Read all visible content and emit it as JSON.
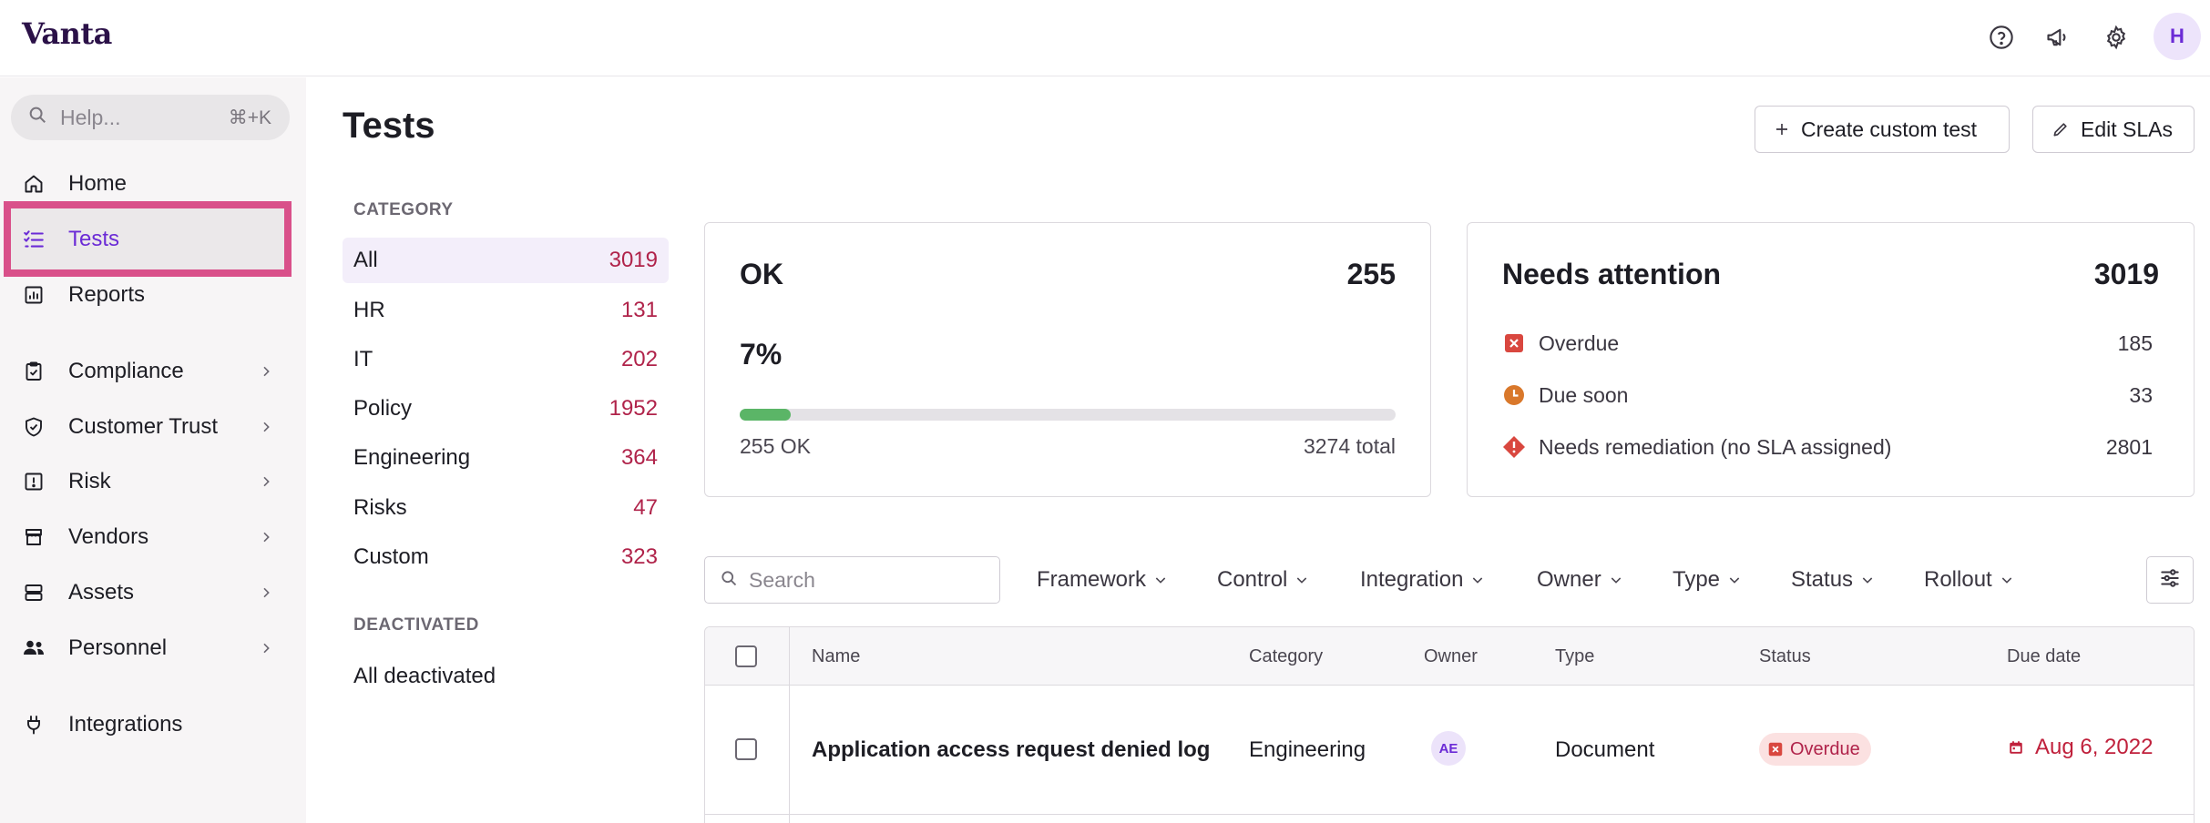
{
  "app": {
    "logo": "Vanta"
  },
  "topbar": {
    "icons": [
      "help-circle-icon",
      "megaphone-icon",
      "gear-icon"
    ],
    "avatar_initial": "H"
  },
  "sidebar": {
    "search": {
      "placeholder": "Help...",
      "shortcut": "⌘+K"
    },
    "items": [
      {
        "label": "Home",
        "icon": "home-icon"
      },
      {
        "label": "Tests",
        "icon": "checklist-icon",
        "active": true
      },
      {
        "label": "Reports",
        "icon": "bar-chart-icon"
      },
      {
        "label": "Compliance",
        "icon": "clipboard-check-icon",
        "chevron": true
      },
      {
        "label": "Customer Trust",
        "icon": "shield-check-icon",
        "chevron": true
      },
      {
        "label": "Risk",
        "icon": "alert-square-icon",
        "chevron": true
      },
      {
        "label": "Vendors",
        "icon": "storefront-icon",
        "chevron": true
      },
      {
        "label": "Assets",
        "icon": "server-icon",
        "chevron": true
      },
      {
        "label": "Personnel",
        "icon": "people-icon",
        "chevron": true
      },
      {
        "label": "Integrations",
        "icon": "plug-icon"
      }
    ]
  },
  "page": {
    "title": "Tests",
    "buttons": {
      "create": "Create custom test",
      "edit_slas": "Edit SLAs"
    }
  },
  "categories": {
    "heading": "CATEGORY",
    "items": [
      {
        "label": "All",
        "count": "3019",
        "active": true
      },
      {
        "label": "HR",
        "count": "131"
      },
      {
        "label": "IT",
        "count": "202"
      },
      {
        "label": "Policy",
        "count": "1952"
      },
      {
        "label": "Engineering",
        "count": "364"
      },
      {
        "label": "Risks",
        "count": "47"
      },
      {
        "label": "Custom",
        "count": "323"
      }
    ],
    "deactivated_heading": "DEACTIVATED",
    "deactivated_item": "All deactivated"
  },
  "ok_card": {
    "title": "OK",
    "count": "255",
    "percent": "7%",
    "progress_fraction": 0.078,
    "ok_label": "255 OK",
    "total_label": "3274 total"
  },
  "attention_card": {
    "title": "Needs attention",
    "count": "3019",
    "rows": [
      {
        "label": "Overdue",
        "value": "185",
        "icon": "overdue-x-icon",
        "color": "#d9473f"
      },
      {
        "label": "Due soon",
        "value": "33",
        "icon": "clock-icon",
        "color": "#d9782b"
      },
      {
        "label": "Needs remediation (no SLA assigned)",
        "value": "2801",
        "icon": "warning-diamond-icon",
        "color": "#d9473f"
      }
    ]
  },
  "filters": {
    "search_placeholder": "Search",
    "items": [
      "Framework",
      "Control",
      "Integration",
      "Owner",
      "Type",
      "Status",
      "Rollout"
    ]
  },
  "table": {
    "headers": [
      "Name",
      "Category",
      "Owner",
      "Type",
      "Status",
      "Due date"
    ],
    "rows": [
      {
        "name": "Application access request denied log",
        "category": "Engineering",
        "owner_initials": "AE",
        "type": "Document",
        "status": "Overdue",
        "due_date": "Aug 6, 2022"
      }
    ]
  },
  "colors": {
    "accent": "#6b2bd6",
    "highlight_border": "#d9508a",
    "count_red": "#b0234a",
    "progress_green": "#5bb567"
  }
}
